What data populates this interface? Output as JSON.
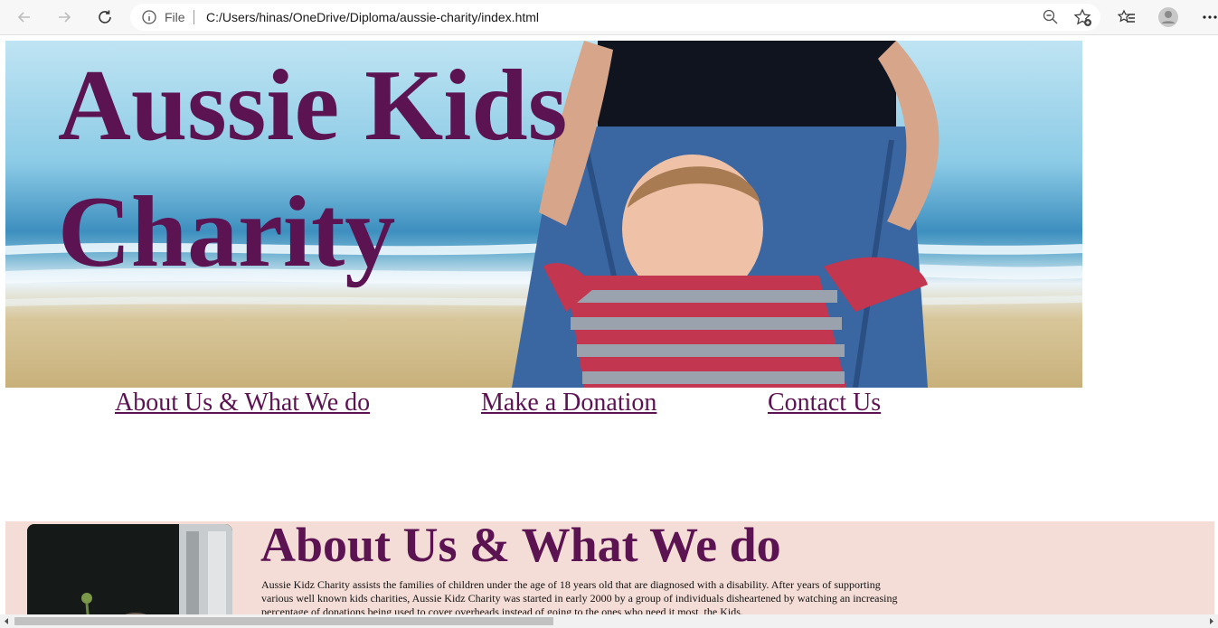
{
  "browser": {
    "address_scheme": "File",
    "url": "C:/Users/hinas/OneDrive/Diploma/aussie-charity/index.html",
    "icons": [
      "back-icon",
      "forward-icon",
      "refresh-icon",
      "info-icon",
      "zoom-out-icon",
      "add-favorite-icon",
      "favorites-icon",
      "profile-icon",
      "more-icon"
    ]
  },
  "page": {
    "hero_title": "Aussie Kids Charity",
    "nav": {
      "about": "About Us & What We do",
      "donation": "Make a Donation",
      "contact": "Contact Us"
    },
    "about": {
      "heading": "About Us & What We do",
      "text": "Aussie Kidz Charity assists the families of children under the age of 18 years old that are diagnosed with a disability. After years of supporting various well known kids charities, Aussie Kidz Charity was started in early 2000 by a group of individuals disheartened by watching an increasing percentage of donations being used to cover overheads instead of going to the ones who need it most, the Kids."
    }
  },
  "colors": {
    "brand": "#5c1352",
    "about_bg": "#f4ddd6"
  }
}
